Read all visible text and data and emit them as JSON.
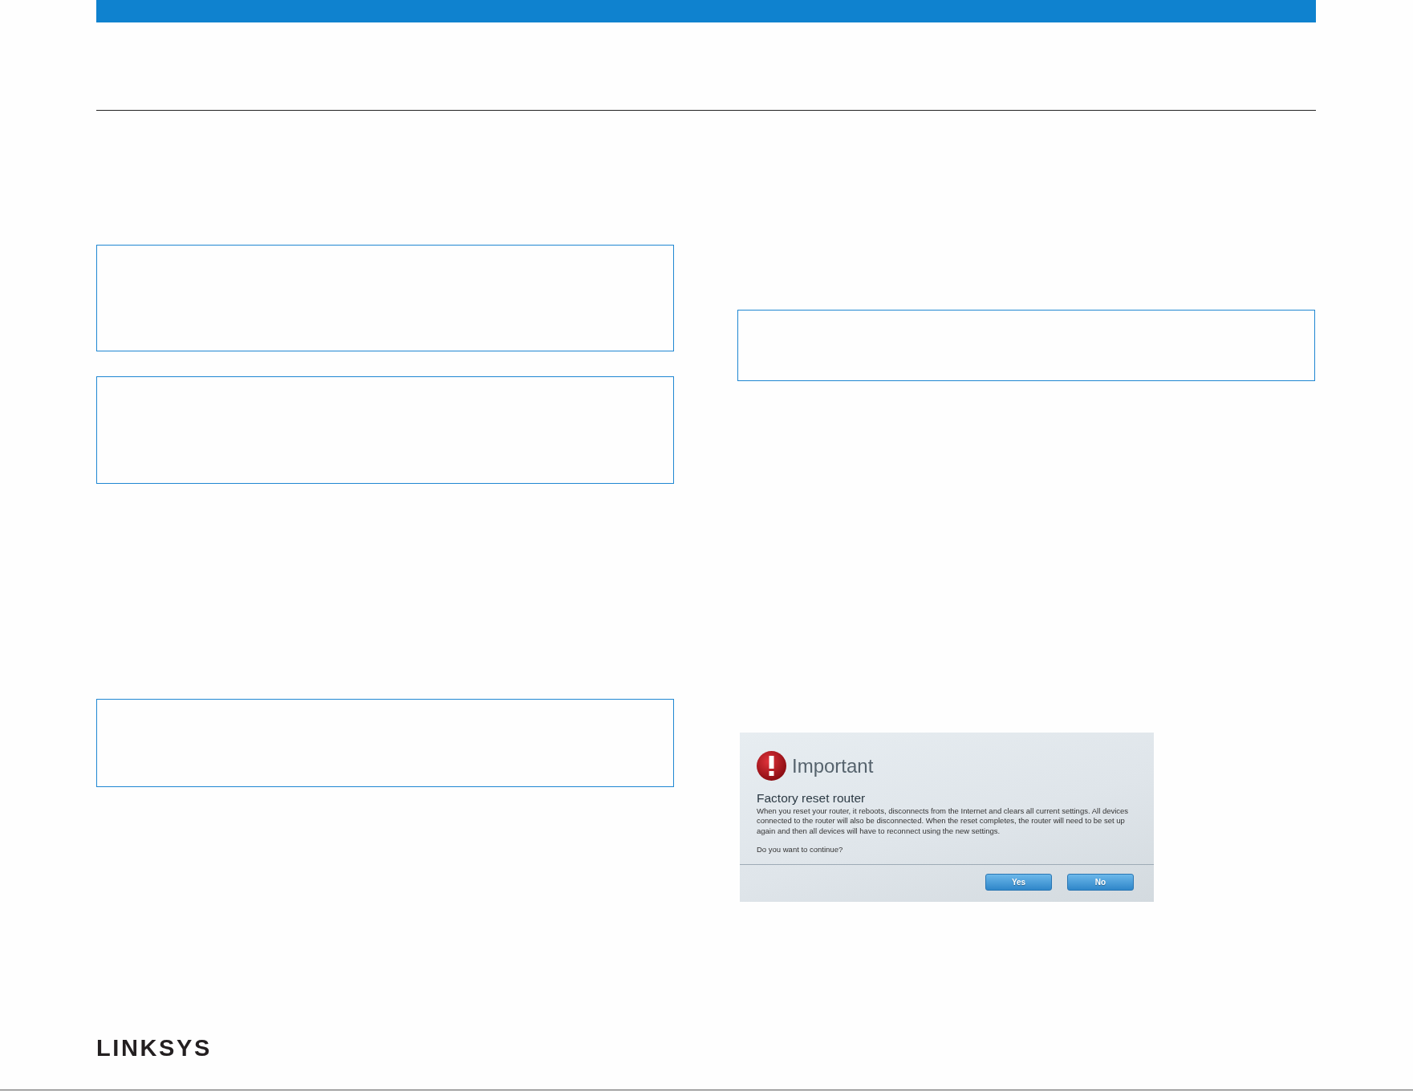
{
  "screenshot": {
    "title": "Important",
    "heading": "Factory reset router",
    "message": "When you reset your router, it reboots, disconnects from the Internet and clears all current settings. All devices connected to the router will also be disconnected. When the reset completes, the router will need to be set up again and then all devices will have to reconnect using the new settings.",
    "question": "Do you want to continue?",
    "buttons": [
      "Yes",
      "No"
    ]
  },
  "footer": {
    "logo": "LINKSYS"
  }
}
